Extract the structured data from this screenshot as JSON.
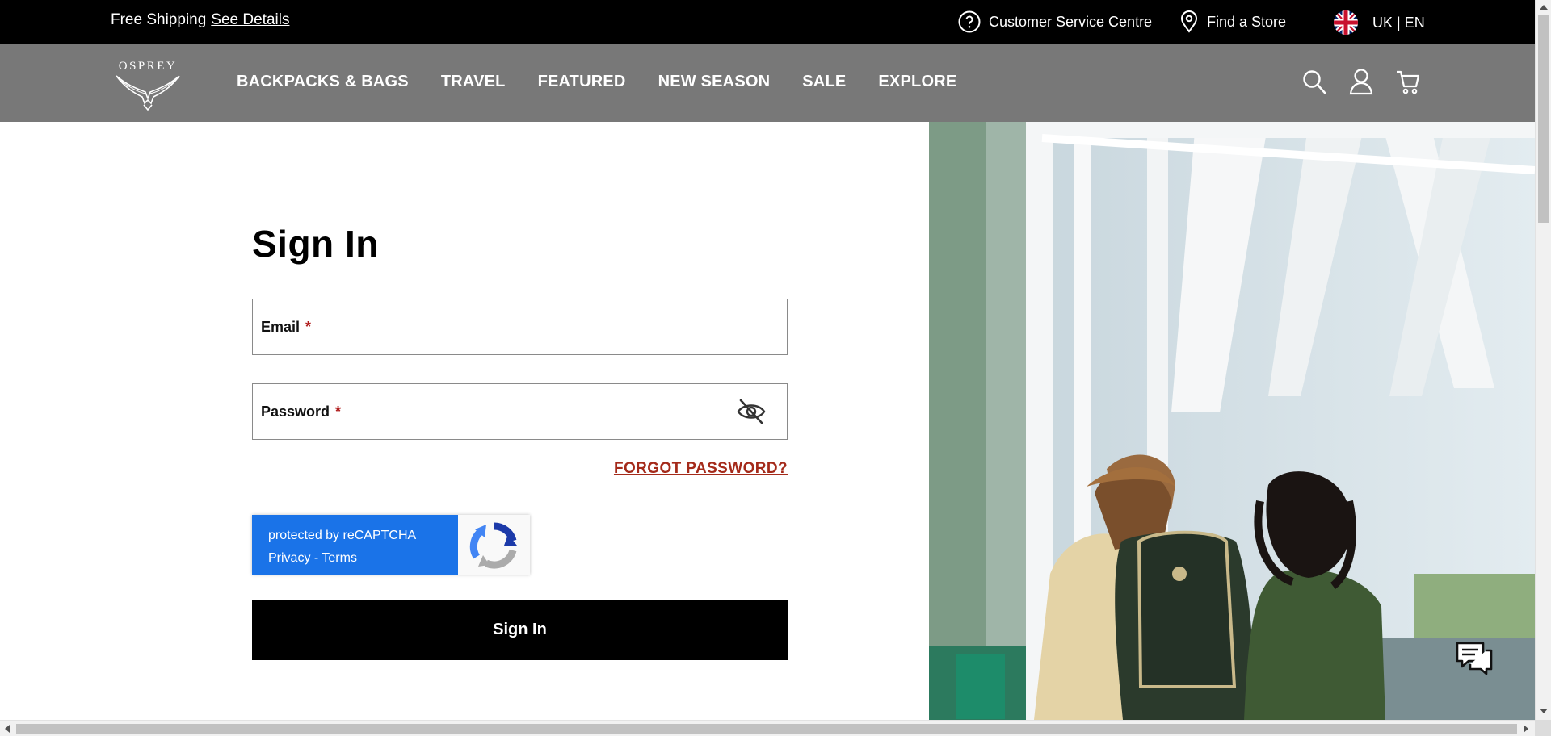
{
  "topbar": {
    "shipping_text": "Free Shipping",
    "shipping_link": "See Details",
    "customer_service": "Customer Service Centre",
    "find_store": "Find a Store",
    "locale": "UK | EN"
  },
  "nav": {
    "logo_text": "OSPREY",
    "items": [
      {
        "label": "BACKPACKS & BAGS"
      },
      {
        "label": "TRAVEL"
      },
      {
        "label": "FEATURED"
      },
      {
        "label": "NEW SEASON"
      },
      {
        "label": "SALE"
      },
      {
        "label": "EXPLORE"
      }
    ],
    "icons": [
      "search-icon",
      "account-icon",
      "cart-icon"
    ]
  },
  "form": {
    "title": "Sign In",
    "email_label": "Email",
    "password_label": "Password",
    "required_mark": "*",
    "forgot_password": "FORGOT PASSWORD?",
    "recaptcha_text": "protected by reCAPTCHA",
    "recaptcha_privacy": "Privacy",
    "recaptcha_sep": " - ",
    "recaptcha_terms": "Terms",
    "submit_label": "Sign In"
  },
  "colors": {
    "topbar_bg": "#000000",
    "nav_bg": "#787878",
    "required": "#b01b1b",
    "forgot_link": "#a42a1a",
    "recaptcha_blue": "#1a73e8",
    "button_bg": "#000000"
  }
}
